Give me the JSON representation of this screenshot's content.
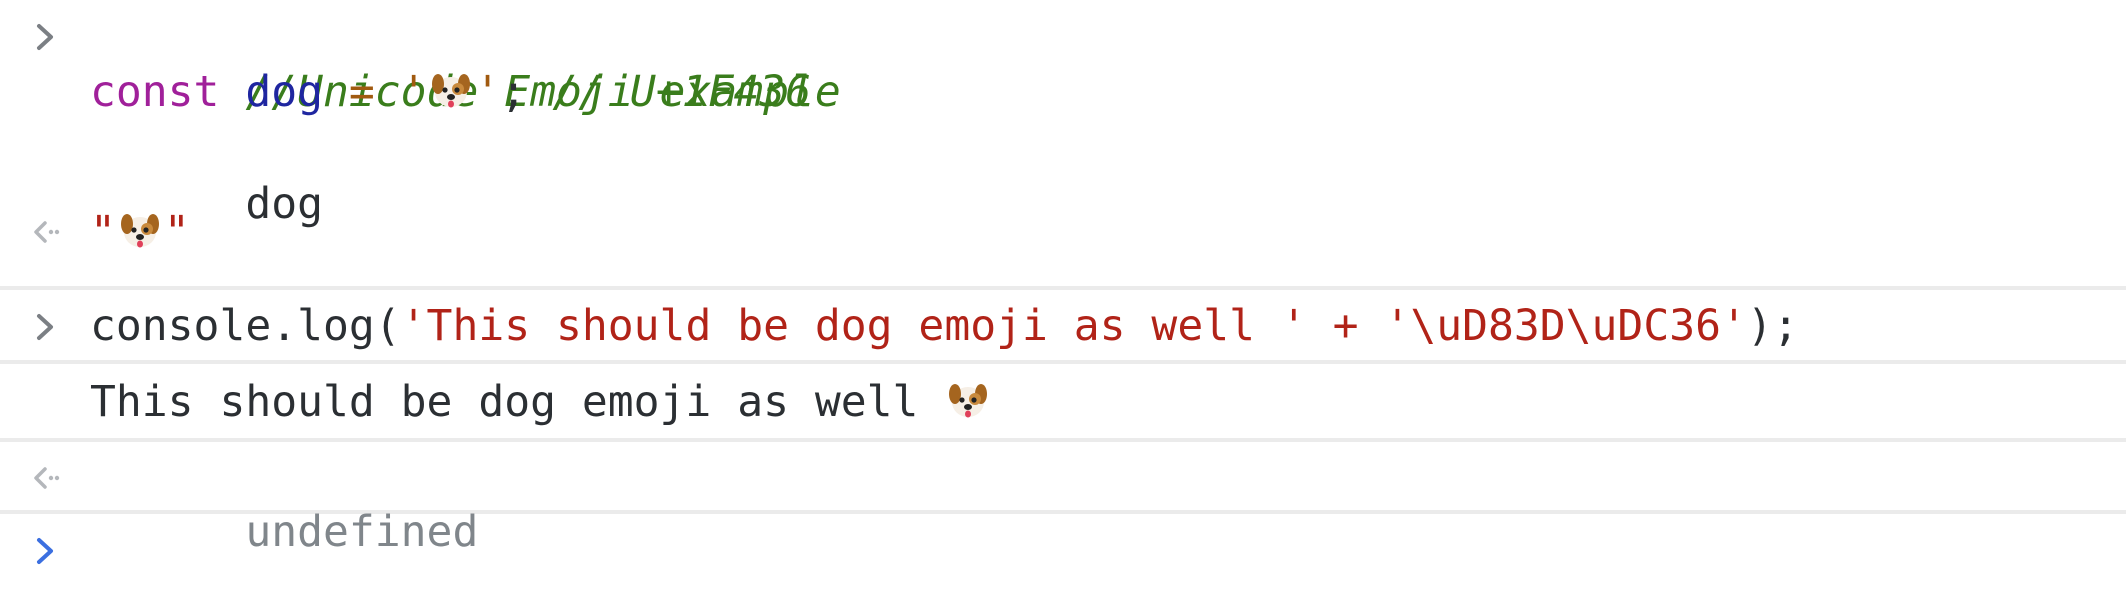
{
  "entries": [
    {
      "kind": "input",
      "lines": {
        "comment": "//Unicode Emoji example",
        "l2_keyword": "const",
        "l2_var": "dog",
        "l2_eq": "=",
        "l2_quote_open": "'",
        "l2_quote_close": "'",
        "l2_semicolon": ";",
        "l2_comment": "// U+1F436",
        "l3": "dog"
      },
      "prompt_icon": "chevron-right-icon"
    },
    {
      "kind": "result",
      "quote_open": "\"",
      "quote_close": "\"",
      "prompt_icon": "return-arrow-icon"
    },
    {
      "kind": "input",
      "code_prefix": "console.log(",
      "code_str1": "'This should be dog emoji as well '",
      "code_plus": " + ",
      "code_str2": "'\\uD83D\\uDC36'",
      "code_suffix": ");",
      "prompt_icon": "chevron-right-icon"
    },
    {
      "kind": "log",
      "text": "This should be dog emoji as well "
    },
    {
      "kind": "result",
      "text": "undefined",
      "prompt_icon": "return-arrow-icon"
    },
    {
      "kind": "prompt",
      "prompt_icon": "chevron-right-icon",
      "accent": "#3b6fe0"
    }
  ],
  "emoji": "dog-face-emoji",
  "colors": {
    "comment": "#3a7d1c",
    "keyword": "#a0209a",
    "variable": "#1f26a0",
    "operator": "#a15a10",
    "string": "#b12318",
    "text": "#2b2f33",
    "muted": "#80868b",
    "divider": "#ebebeb",
    "prompt_active": "#3b6fe0"
  }
}
